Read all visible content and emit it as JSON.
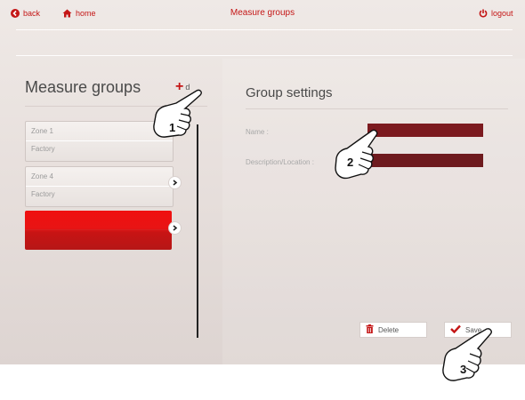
{
  "topbar": {
    "back_label": "back",
    "home_label": "home",
    "title": "Measure groups",
    "logout_label": "logout"
  },
  "left": {
    "title": "Measure groups",
    "add_label": "d"
  },
  "groups": [
    {
      "name": "Zone 1",
      "location": "Factory"
    },
    {
      "name": "Zone 4",
      "location": "Factory"
    },
    {
      "name": "",
      "location": ""
    }
  ],
  "right": {
    "title": "Group settings",
    "name_label": "Name :",
    "description_label": "Description/Location :",
    "name_value": "",
    "description_value": ""
  },
  "buttons": {
    "delete_label": "Delete",
    "save_label": "Save"
  },
  "steps": [
    "1",
    "2",
    "3"
  ],
  "colors": {
    "accent": "#c41616",
    "selected_card": "#e81414",
    "input_fill": "#7c1a1f"
  }
}
